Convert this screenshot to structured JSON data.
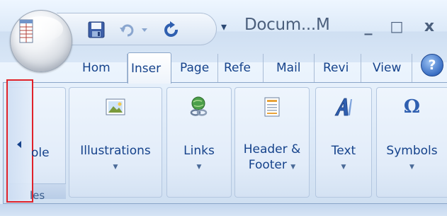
{
  "window": {
    "title": "Docum...M",
    "minimize_glyph": "_",
    "maximize_glyph": "□",
    "close_glyph": "x"
  },
  "quick_access_toolbar": {
    "icons": [
      "save-icon",
      "undo-icon",
      "dropdown-arrow-icon",
      "redo-icon",
      "customize-qat-icon"
    ],
    "customize_glyph": "▾"
  },
  "tabs": [
    {
      "label": "Hom",
      "active": false
    },
    {
      "label": "Inser",
      "active": true
    },
    {
      "label": "Page",
      "active": false
    },
    {
      "label": "Refe",
      "active": false
    },
    {
      "label": "Mail",
      "active": false
    },
    {
      "label": "Revi",
      "active": false
    },
    {
      "label": "View",
      "active": false
    }
  ],
  "help": {
    "glyph": "?"
  },
  "ribbon": {
    "tables_group": {
      "visible_label_fragment": "ole",
      "visible_footer_fragment": "les"
    },
    "scroll_left_button": {
      "icon": "scroll-left-arrow-icon",
      "highlight_color": "#e0222a"
    },
    "groups": [
      {
        "label": "Illustrations",
        "icon": "picture-icon",
        "has_dropdown": true
      },
      {
        "label": "Links",
        "icon": "globe-link-icon",
        "has_dropdown": true
      },
      {
        "label_line1": "Header &",
        "label_line2": "Footer",
        "icon": "header-footer-icon",
        "has_dropdown": true
      },
      {
        "label": "Text",
        "icon": "wordart-icon",
        "has_dropdown": true
      },
      {
        "label": "Symbols",
        "icon": "omega-icon",
        "symbol_glyph": "Ω",
        "has_dropdown": true
      }
    ]
  },
  "colors": {
    "accent_text": "#15428b",
    "highlight_border": "#e0222a"
  }
}
